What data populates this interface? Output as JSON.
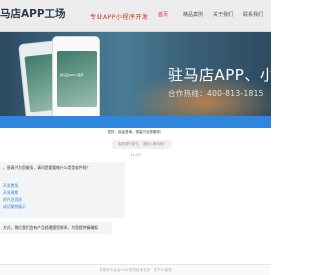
{
  "header": {
    "brand": "马店APP工场",
    "slogan": "专业APP小程序开发",
    "nav": [
      {
        "label": "首页",
        "active": true
      },
      {
        "label": "精品案例",
        "active": false
      },
      {
        "label": "关于我们",
        "active": false
      },
      {
        "label": "联系我们",
        "active": false
      }
    ]
  },
  "hero": {
    "title": "驻马店APP、小程序开",
    "phone": "合作热线：400-813-1815",
    "phone_screen_text": "驻马店APP小程序"
  },
  "chat": {
    "greeting": "您好，欢迎咨询，很高兴为您服务！",
    "system_notice": "客服暂时繁忙，请耐心等待哦~",
    "timestamp": "11:09",
    "bubble_lines": [
      "，很高兴为您服务，请问您需要做什么类型软件呢？"
    ],
    "bubble_links": [
      "开发费用",
      "开发周期",
      "的开发资质",
      "成功案例展示"
    ],
    "notice": "方式，稍后我们会有产品经理跟您联系，为您提供精确报"
  },
  "footer": {
    "text": "本服务平台由53KF提供技术支持 · 关于53客服"
  },
  "colors": {
    "accent_blue": "#2e86de",
    "nav_active": "#e02a2a",
    "slogan": "#c8361c"
  }
}
